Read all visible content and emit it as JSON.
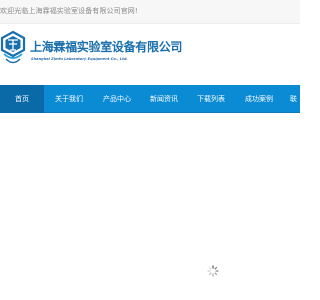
{
  "topbar": {
    "welcome_text": "欢迎光临上海霖福实验室设备有限公司官网!"
  },
  "logo": {
    "company_cn": "上海霖福实验室设备有限公司",
    "company_en": "Shanghai Zimfu Laboratory Equipment Co., Ltd."
  },
  "nav": {
    "items": [
      {
        "label": "首页",
        "active": true
      },
      {
        "label": "关于我们"
      },
      {
        "label": "产品中心"
      },
      {
        "label": "新闻资讯"
      },
      {
        "label": "下载列表"
      },
      {
        "label": "成功案例"
      },
      {
        "label": "联"
      }
    ]
  },
  "colors": {
    "nav_bg": "#0a8bd4",
    "nav_active": "#0a6aa7",
    "brand_blue": "#1a6fad"
  },
  "icons": {
    "logo_mark": "hexagon-logo-icon",
    "loading": "spinner-icon"
  }
}
